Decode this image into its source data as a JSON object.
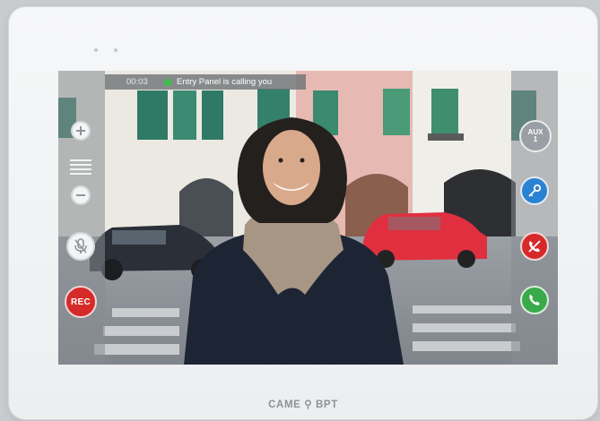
{
  "status_bar": {
    "timer": "00:03",
    "message": "Entry Panel is calling you"
  },
  "left_controls": {
    "zoom_in_icon": "plus-icon",
    "menu_icon": "menu-lines-icon",
    "zoom_out_icon": "minus-icon",
    "mute_icon": "microphone-mute-icon",
    "rec_label": "REC"
  },
  "right_controls": {
    "aux_label_top": "AUX",
    "aux_label_bottom": "1",
    "key_icon": "key-icon",
    "reject_icon": "phone-reject-icon",
    "answer_icon": "phone-answer-icon"
  },
  "brand": {
    "logo_text": "CAME ⚲ BPT"
  },
  "colors": {
    "rec": "#d62a2a",
    "key": "#2a82d2",
    "reject": "#d62a2a",
    "answer": "#3aa94a",
    "status_dot": "#3bc14a"
  }
}
